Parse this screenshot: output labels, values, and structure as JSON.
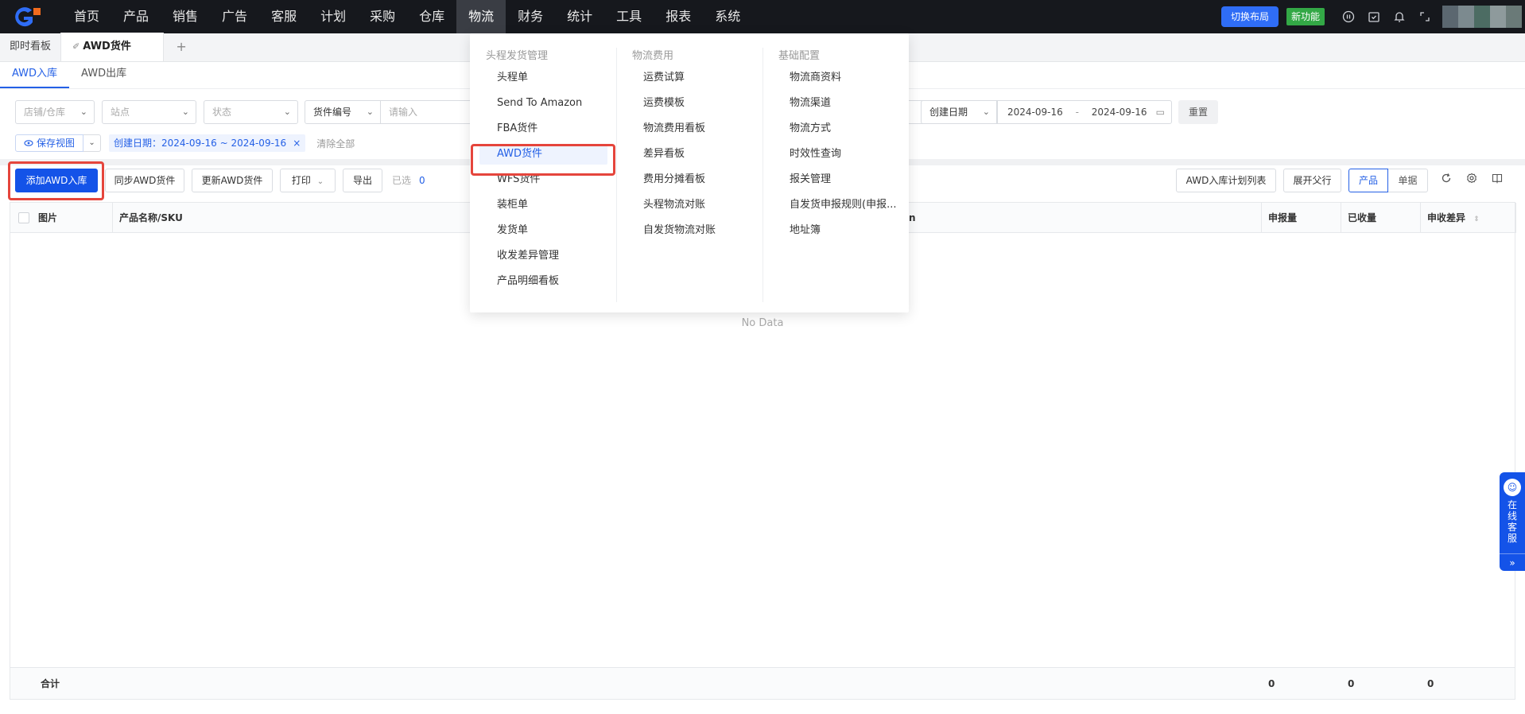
{
  "nav": {
    "items": [
      "首页",
      "产品",
      "销售",
      "广告",
      "客服",
      "计划",
      "采购",
      "仓库",
      "物流",
      "财务",
      "统计",
      "工具",
      "报表",
      "系统"
    ],
    "active_index": 8,
    "switch_layout": "切换布局",
    "new_feature": "新功能"
  },
  "tabs": {
    "dashboard": "即时看板",
    "active": "AWD货件",
    "add": "+"
  },
  "subtabs": [
    "AWD入库",
    "AWD出库"
  ],
  "filters": {
    "shop": "店铺/仓库",
    "site": "站点",
    "status": "状态",
    "shipment_no": "货件编号",
    "input_placeholder": "请输入",
    "date_type": "创建日期",
    "date_start": "2024-09-16",
    "date_sep": "-",
    "date_end": "2024-09-16",
    "reset": "重置",
    "save_view": "保存视图",
    "chip": "创建日期：2024-09-16 ~ 2024-09-16",
    "clear_all": "清除全部"
  },
  "toolbar": {
    "add": "添加AWD入库",
    "sync": "同步AWD货件",
    "update": "更新AWD货件",
    "print": "打印",
    "export": "导出",
    "selected_label": "已选",
    "selected_count": "0",
    "plan_list": "AWD入库计划列表",
    "expand": "展开父行",
    "view_product": "产品",
    "view_doc": "单据"
  },
  "table": {
    "headers": {
      "image": "图片",
      "name": "产品名称/SKU",
      "truncated": "n",
      "declared": "申报量",
      "received": "已收量",
      "diff": "申收差异"
    },
    "no_data": "No Data",
    "footer": {
      "total": "合计",
      "declared": "0",
      "received": "0",
      "diff": "0"
    }
  },
  "menu": {
    "col1": {
      "title": "头程发货管理",
      "items": [
        "头程单",
        "Send To Amazon",
        "FBA货件",
        "AWD货件",
        "WFS货件",
        "装柜单",
        "发货单",
        "收发差异管理",
        "产品明细看板"
      ]
    },
    "col2": {
      "title": "物流费用",
      "items": [
        "运费试算",
        "运费模板",
        "物流费用看板",
        "差异看板",
        "费用分摊看板",
        "头程物流对账",
        "自发货物流对账"
      ]
    },
    "col3": {
      "title": "基础配置",
      "items": [
        "物流商资料",
        "物流渠道",
        "物流方式",
        "时效性查询",
        "报关管理",
        "自发货申报规则(申报...",
        "地址簿"
      ]
    }
  },
  "float_service": {
    "label": "在线客服",
    "more": "»"
  },
  "colors": {
    "primary": "#1453e8",
    "nav_bg": "#16181d",
    "highlight": "#e5453c",
    "new_badge": "#33a846"
  }
}
